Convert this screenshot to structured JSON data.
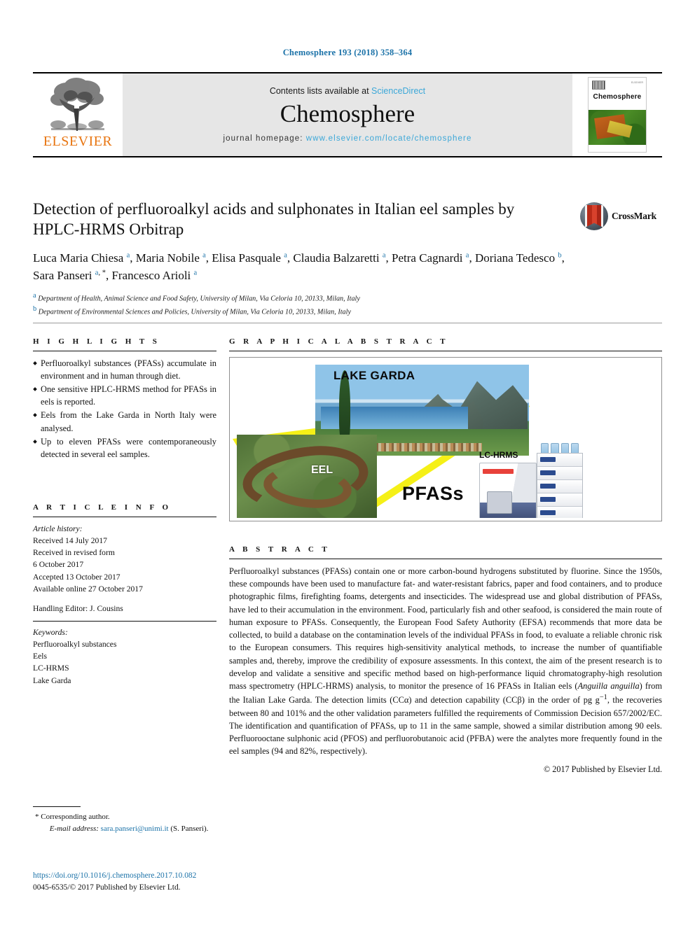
{
  "running_head": "Chemosphere 193 (2018) 358–364",
  "masthead": {
    "publisher_logo_text": "ELSEVIER",
    "contents_prefix": "Contents lists available at",
    "contents_link": "ScienceDirect",
    "journal_name": "Chemosphere",
    "homepage_prefix": "journal homepage:",
    "homepage_url": "www.elsevier.com/locate/chemosphere",
    "cover_title": "Chemosphere",
    "cover_corner_text": "ELSEVIER"
  },
  "article": {
    "title": "Detection of perfluoroalkyl acids and sulphonates in Italian eel samples by HPLC-HRMS Orbitrap",
    "crossmark_label": "CrossMark",
    "authors": [
      {
        "name": "Luca Maria Chiesa",
        "marks": [
          "a"
        ],
        "sep": ", "
      },
      {
        "name": "Maria Nobile",
        "marks": [
          "a"
        ],
        "sep": ", "
      },
      {
        "name": "Elisa Pasquale",
        "marks": [
          "a"
        ],
        "sep": ", "
      },
      {
        "name": "Claudia Balzaretti",
        "marks": [
          "a"
        ],
        "sep": ", "
      },
      {
        "name": "Petra Cagnardi",
        "marks": [
          "a"
        ],
        "sep": ", "
      },
      {
        "name": "Doriana Tedesco",
        "marks": [
          "b"
        ],
        "sep": ", "
      },
      {
        "name": "Sara Panseri",
        "marks": [
          "a",
          "*"
        ],
        "sep": ", "
      },
      {
        "name": "Francesco Arioli",
        "marks": [
          "a"
        ],
        "sep": ""
      }
    ],
    "affiliations": [
      {
        "mark": "a",
        "text": "Department of Health, Animal Science and Food Safety, University of Milan, Via Celoria 10, 20133, Milan, Italy"
      },
      {
        "mark": "b",
        "text": "Department of Environmental Sciences and Policies, University of Milan, Via Celoria 10, 20133, Milan, Italy"
      }
    ]
  },
  "highlights": {
    "heading": "H I G H L I G H T S",
    "items": [
      "Perfluoroalkyl substances (PFASs) accumulate in environment and in human through diet.",
      "One sensitive HPLC-HRMS method for PFASs in eels is reported.",
      "Eels from the Lake Garda in North Italy were analysed.",
      "Up to eleven PFASs were contemporaneously detected in several eel samples."
    ]
  },
  "graphical_abstract": {
    "heading": "G R A P H I C A L   A B S T R A C T",
    "labels": {
      "lake": "LAKE GARDA",
      "eel": "EEL",
      "pfass": "PFASs",
      "instrument": "LC-HRMS"
    }
  },
  "article_info": {
    "heading": "A R T I C L E   I N F O",
    "history_label": "Article history:",
    "history": [
      "Received 14 July 2017",
      "Received in revised form",
      "6 October 2017",
      "Accepted 13 October 2017",
      "Available online 27 October 2017"
    ],
    "handling_editor": "Handling Editor: J. Cousins",
    "keywords_label": "Keywords:",
    "keywords": [
      "Perfluoroalkyl substances",
      "Eels",
      "LC-HRMS",
      "Lake Garda"
    ]
  },
  "abstract": {
    "heading": "A B S T R A C T",
    "part1": "Perfluoroalkyl substances (PFASs) contain one or more carbon-bound hydrogens substituted by fluorine. Since the 1950s, these compounds have been used to manufacture fat- and water-resistant fabrics, paper and food containers, and to produce photographic films, firefighting foams, detergents and insecticides. The widespread use and global distribution of PFASs, have led to their accumulation in the environment. Food, particularly fish and other seafood, is considered the main route of human exposure to PFASs. Consequently, the European Food Safety Authority (EFSA) recommends that more data be collected, to build a database on the contamination levels of the individual PFASs in food, to evaluate a reliable chronic risk to the European consumers. This requires high-sensitivity analytical methods, to increase the number of quantifiable samples and, thereby, improve the credibility of exposure assessments. In this context, the aim of the present research is to develop and validate a sensitive and specific method based on high-performance liquid chromatography-high resolution mass spectrometry (HPLC-HRMS) analysis, to monitor the presence of 16 PFASs in Italian eels (",
    "italic1": "Anguilla anguilla",
    "part2": ") from the Italian Lake Garda. The detection limits (CCα) and detection capability (CCβ) in the order of pg g",
    "sup1": "−1",
    "part3": ", the recoveries between 80 and 101% and the other validation parameters fulfilled the requirements of Commission Decision 657/2002/EC. The identification and quantification of PFASs, up to 11 in the same sample, showed a similar distribution among 90 eels. Perfluorooctane sulphonic acid (PFOS) and perfluorobutanoic acid (PFBA) were the analytes more frequently found in the eel samples (94 and 82%, respectively).",
    "copyright": "© 2017 Published by Elsevier Ltd."
  },
  "footer": {
    "corresponding_marker": "*",
    "corresponding_label": "Corresponding author.",
    "email_label": "E-mail address:",
    "email": "sara.panseri@unimi.it",
    "email_owner": "(S. Panseri).",
    "doi": "https://doi.org/10.1016/j.chemosphere.2017.10.082",
    "issn_line": "0045-6535/© 2017 Published by Elsevier Ltd."
  }
}
